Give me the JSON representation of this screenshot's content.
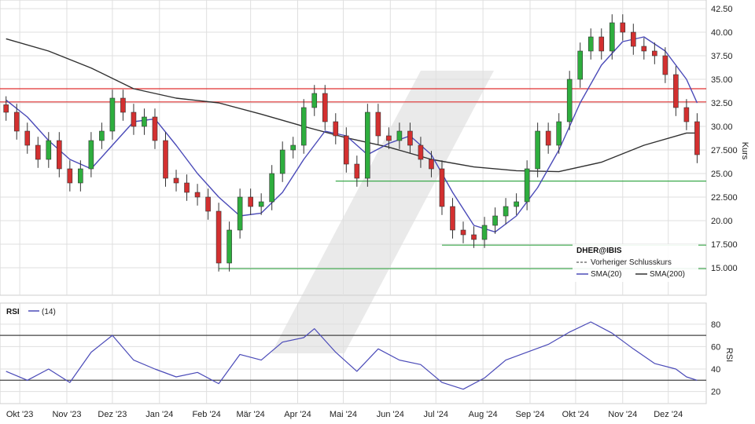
{
  "chart_data": [
    {
      "type": "candlestick",
      "ticker_label": "DHER@IBIS",
      "ylabel": "Kurs",
      "ylim": [
        12.5,
        43.0
      ],
      "y_ticks": [
        "15.000",
        "17.500",
        "20.00",
        "22.500",
        "25.00",
        "27.500",
        "30.00",
        "32.50",
        "35.00",
        "37.50",
        "40.00",
        "42.50"
      ],
      "x_ticks": [
        "Okt '23",
        "Nov '23",
        "Dez '23",
        "Jan '24",
        "Feb '24",
        "Mär '24",
        "Apr '24",
        "Mai '24",
        "Jun '24",
        "Jul '24",
        "Aug '24",
        "Sep '24",
        "Okt '24",
        "Nov '24",
        "Dez '24"
      ],
      "horizontal_lines": [
        {
          "value": 34.0,
          "color": "#e03030"
        },
        {
          "value": 32.6,
          "color": "#e03030"
        },
        {
          "value": 24.2,
          "color": "#3aa84a"
        },
        {
          "value": 17.4,
          "color": "#3aa84a"
        },
        {
          "value": 14.9,
          "color": "#3aa84a"
        }
      ],
      "close_series": {
        "name": "DHER@IBIS",
        "points": [
          [
            "2023-09-22",
            31.5
          ],
          [
            "2023-09-29",
            29.5
          ],
          [
            "2023-10-06",
            28.0
          ],
          [
            "2023-10-13",
            26.5
          ],
          [
            "2023-10-20",
            28.5
          ],
          [
            "2023-10-27",
            25.5
          ],
          [
            "2023-11-03",
            24.0
          ],
          [
            "2023-11-10",
            25.5
          ],
          [
            "2023-11-17",
            28.5
          ],
          [
            "2023-11-24",
            29.5
          ],
          [
            "2023-12-01",
            33.0
          ],
          [
            "2023-12-08",
            31.5
          ],
          [
            "2023-12-15",
            30.0
          ],
          [
            "2023-12-22",
            31.0
          ],
          [
            "2023-12-29",
            28.5
          ],
          [
            "2024-01-05",
            24.5
          ],
          [
            "2024-01-12",
            24.0
          ],
          [
            "2024-01-19",
            23.0
          ],
          [
            "2024-01-26",
            22.5
          ],
          [
            "2024-02-02",
            21.0
          ],
          [
            "2024-02-09",
            15.5
          ],
          [
            "2024-02-16",
            19.0
          ],
          [
            "2024-02-23",
            22.5
          ],
          [
            "2024-03-01",
            21.5
          ],
          [
            "2024-03-08",
            22.0
          ],
          [
            "2024-03-15",
            25.0
          ],
          [
            "2024-03-22",
            27.5
          ],
          [
            "2024-03-29",
            28.0
          ],
          [
            "2024-04-05",
            32.0
          ],
          [
            "2024-04-12",
            33.5
          ],
          [
            "2024-04-19",
            30.5
          ],
          [
            "2024-04-26",
            29.0
          ],
          [
            "2024-05-03",
            26.0
          ],
          [
            "2024-05-10",
            24.5
          ],
          [
            "2024-05-17",
            31.5
          ],
          [
            "2024-05-24",
            29.0
          ],
          [
            "2024-05-31",
            28.5
          ],
          [
            "2024-06-07",
            29.5
          ],
          [
            "2024-06-14",
            28.0
          ],
          [
            "2024-06-21",
            26.5
          ],
          [
            "2024-06-28",
            25.5
          ],
          [
            "2024-07-05",
            21.5
          ],
          [
            "2024-07-12",
            19.0
          ],
          [
            "2024-07-19",
            18.5
          ],
          [
            "2024-07-26",
            18.0
          ],
          [
            "2024-08-02",
            19.5
          ],
          [
            "2024-08-09",
            20.5
          ],
          [
            "2024-08-16",
            21.5
          ],
          [
            "2024-08-23",
            22.0
          ],
          [
            "2024-08-30",
            25.5
          ],
          [
            "2024-09-06",
            29.5
          ],
          [
            "2024-09-13",
            28.0
          ],
          [
            "2024-09-20",
            30.5
          ],
          [
            "2024-09-27",
            35.0
          ],
          [
            "2024-10-04",
            38.0
          ],
          [
            "2024-10-11",
            39.5
          ],
          [
            "2024-10-18",
            38.0
          ],
          [
            "2024-10-25",
            41.0
          ],
          [
            "2024-11-01",
            40.0
          ],
          [
            "2024-11-08",
            38.5
          ],
          [
            "2024-11-15",
            38.0
          ],
          [
            "2024-11-22",
            37.5
          ],
          [
            "2024-11-29",
            35.5
          ],
          [
            "2024-12-06",
            32.0
          ],
          [
            "2024-12-13",
            30.5
          ],
          [
            "2024-12-20",
            27.0
          ]
        ]
      },
      "sma20": {
        "name": "SMA(20)",
        "points": [
          [
            "2023-09-22",
            32.8
          ],
          [
            "2023-10-06",
            31.0
          ],
          [
            "2023-10-20",
            28.5
          ],
          [
            "2023-11-03",
            26.5
          ],
          [
            "2023-11-17",
            25.5
          ],
          [
            "2023-12-01",
            28.0
          ],
          [
            "2023-12-15",
            30.5
          ],
          [
            "2023-12-29",
            30.8
          ],
          [
            "2024-01-12",
            28.0
          ],
          [
            "2024-01-26",
            25.0
          ],
          [
            "2024-02-09",
            22.5
          ],
          [
            "2024-02-23",
            20.5
          ],
          [
            "2024-03-08",
            20.8
          ],
          [
            "2024-03-22",
            23.0
          ],
          [
            "2024-04-05",
            26.5
          ],
          [
            "2024-04-19",
            29.5
          ],
          [
            "2024-05-03",
            29.0
          ],
          [
            "2024-05-17",
            27.0
          ],
          [
            "2024-05-31",
            28.2
          ],
          [
            "2024-06-14",
            29.0
          ],
          [
            "2024-06-28",
            27.0
          ],
          [
            "2024-07-12",
            23.0
          ],
          [
            "2024-07-26",
            19.5
          ],
          [
            "2024-08-09",
            18.8
          ],
          [
            "2024-08-23",
            20.5
          ],
          [
            "2024-09-06",
            23.5
          ],
          [
            "2024-09-20",
            27.5
          ],
          [
            "2024-10-04",
            32.5
          ],
          [
            "2024-10-18",
            36.5
          ],
          [
            "2024-11-01",
            39.0
          ],
          [
            "2024-11-15",
            39.5
          ],
          [
            "2024-11-29",
            38.0
          ],
          [
            "2024-12-13",
            35.0
          ],
          [
            "2024-12-20",
            32.5
          ]
        ]
      },
      "sma200": {
        "name": "SMA(200)",
        "points": [
          [
            "2023-09-22",
            39.3
          ],
          [
            "2023-10-20",
            38.0
          ],
          [
            "2023-11-17",
            36.2
          ],
          [
            "2023-12-15",
            34.0
          ],
          [
            "2024-01-12",
            33.0
          ],
          [
            "2024-02-09",
            32.5
          ],
          [
            "2024-03-08",
            31.3
          ],
          [
            "2024-04-05",
            30.0
          ],
          [
            "2024-05-03",
            28.8
          ],
          [
            "2024-05-31",
            27.8
          ],
          [
            "2024-06-28",
            26.5
          ],
          [
            "2024-07-26",
            25.7
          ],
          [
            "2024-08-23",
            25.3
          ],
          [
            "2024-09-20",
            25.2
          ],
          [
            "2024-10-18",
            26.2
          ],
          [
            "2024-11-15",
            28.0
          ],
          [
            "2024-12-13",
            29.3
          ],
          [
            "2024-12-20",
            29.3
          ]
        ]
      },
      "legend": {
        "title": "DHER@IBIS",
        "items": [
          "Vorheriger Schlusskurs",
          "SMA(20)",
          "SMA(200)"
        ],
        "position": "bottom-right"
      },
      "colors": {
        "up": "#2eae3e",
        "down": "#d33030",
        "sma20": "#4a4ab8",
        "sma200": "#303030",
        "grid": "#dfdfdf"
      }
    },
    {
      "type": "line",
      "title": "RSI",
      "legend_item": "(14)",
      "ylabel": "RSI",
      "ylim": [
        12,
        96
      ],
      "y_ticks": [
        "20",
        "40",
        "60",
        "80"
      ],
      "reference_lines": [
        70,
        30
      ],
      "series": [
        {
          "name": "RSI",
          "points": [
            [
              "2023-09-22",
              38
            ],
            [
              "2023-10-06",
              30
            ],
            [
              "2023-10-20",
              40
            ],
            [
              "2023-11-03",
              28
            ],
            [
              "2023-11-17",
              55
            ],
            [
              "2023-12-01",
              70
            ],
            [
              "2023-12-15",
              48
            ],
            [
              "2023-12-29",
              40
            ],
            [
              "2024-01-12",
              33
            ],
            [
              "2024-01-26",
              37
            ],
            [
              "2024-02-09",
              27
            ],
            [
              "2024-02-23",
              53
            ],
            [
              "2024-03-08",
              48
            ],
            [
              "2024-03-22",
              64
            ],
            [
              "2024-04-05",
              68
            ],
            [
              "2024-04-12",
              76
            ],
            [
              "2024-04-26",
              55
            ],
            [
              "2024-05-10",
              38
            ],
            [
              "2024-05-24",
              58
            ],
            [
              "2024-06-07",
              48
            ],
            [
              "2024-06-21",
              44
            ],
            [
              "2024-07-05",
              28
            ],
            [
              "2024-07-19",
              22
            ],
            [
              "2024-08-02",
              32
            ],
            [
              "2024-08-16",
              48
            ],
            [
              "2024-08-30",
              55
            ],
            [
              "2024-09-13",
              62
            ],
            [
              "2024-09-27",
              73
            ],
            [
              "2024-10-11",
              82
            ],
            [
              "2024-10-25",
              72
            ],
            [
              "2024-11-08",
              58
            ],
            [
              "2024-11-22",
              45
            ],
            [
              "2024-12-06",
              40
            ],
            [
              "2024-12-13",
              33
            ],
            [
              "2024-12-20",
              30
            ]
          ]
        }
      ],
      "colors": {
        "line": "#4a4ab8",
        "reference": "#444444"
      }
    }
  ]
}
